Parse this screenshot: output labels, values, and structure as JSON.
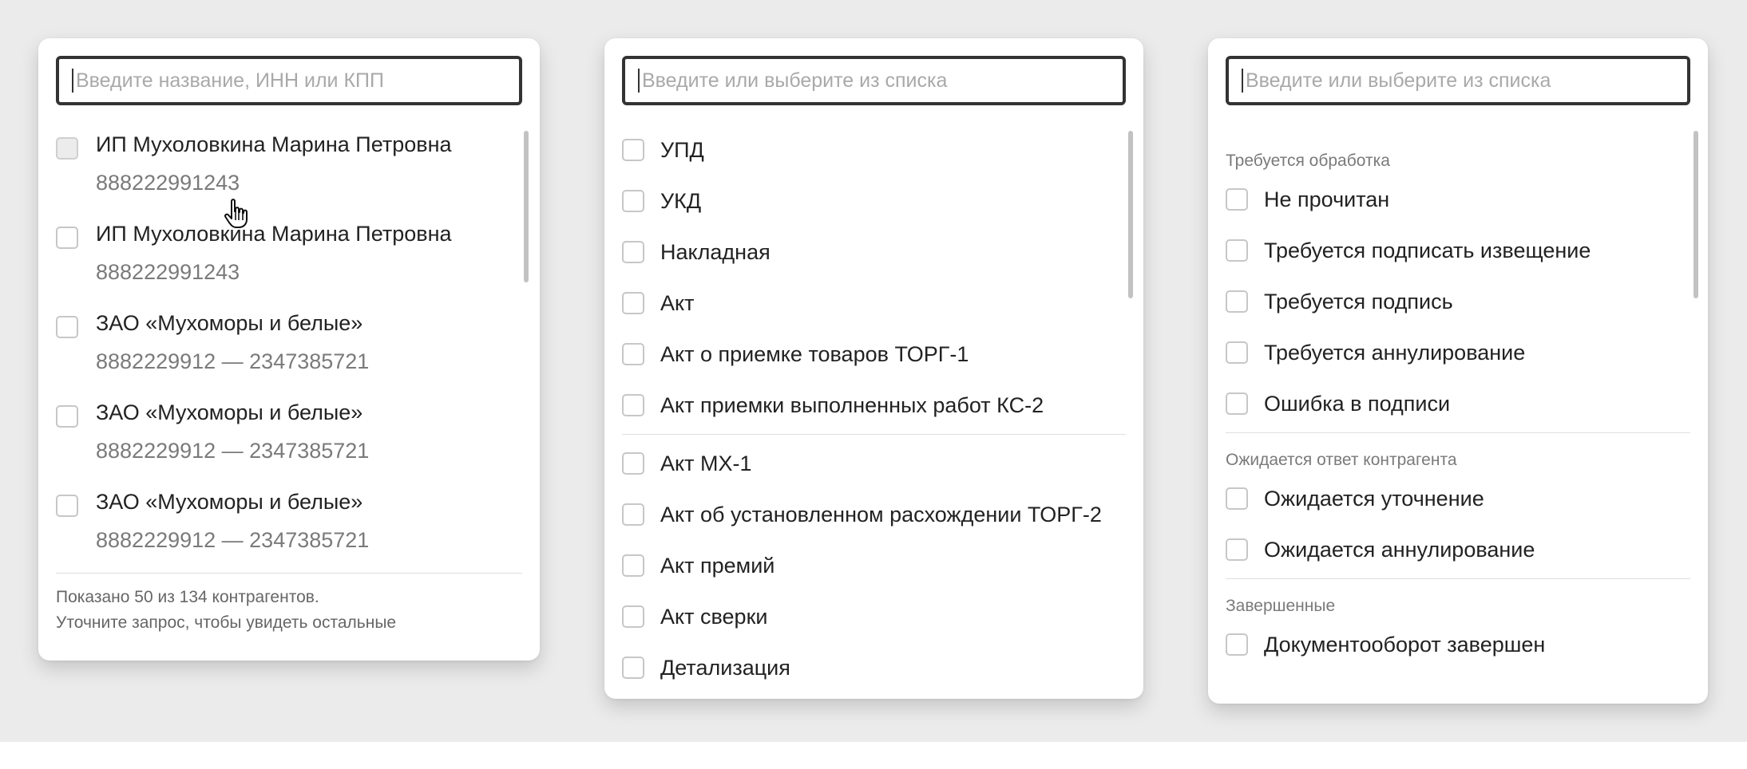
{
  "counterparty_panel": {
    "search_placeholder": "Введите название, ИНН или КПП",
    "items": [
      {
        "name": "ИП Мухоловкина Марина Петровна",
        "inn": "888222991243"
      },
      {
        "name": "ИП Мухоловкина Марина Петровна",
        "inn": "888222991243"
      },
      {
        "name": "ЗАО «Мухоморы и белые»",
        "inn": "8882229912 — 2347385721"
      },
      {
        "name": "ЗАО «Мухоморы и белые»",
        "inn": "8882229912 — 2347385721"
      },
      {
        "name": "ЗАО «Мухоморы и белые»",
        "inn": "8882229912 — 2347385721"
      }
    ],
    "footer_line1": "Показано 50 из 134 контрагентов.",
    "footer_line2": "Уточните запрос, чтобы увидеть остальные"
  },
  "doctype_panel": {
    "search_placeholder": "Введите или выберите из списка",
    "group1": [
      "УПД",
      "УКД",
      "Накладная",
      "Акт",
      "Акт о приемке товаров ТОРГ-1",
      "Акт приемки выполненных работ КС-2"
    ],
    "group2": [
      "Акт МХ-1",
      "Акт об установленном расхождении ТОРГ-2",
      "Акт премий",
      "Акт сверки",
      "Детализация"
    ]
  },
  "status_panel": {
    "search_placeholder": "Введите или выберите из списка",
    "groups": [
      {
        "label": "Требуется обработка",
        "items": [
          "Не прочитан",
          "Требуется подписать извещение",
          "Требуется подпись",
          "Требуется аннулирование",
          "Ошибка в подписи"
        ]
      },
      {
        "label": "Ожидается ответ контрагента",
        "items": [
          "Ожидается уточнение",
          "Ожидается аннулирование"
        ]
      },
      {
        "label": "Завершенные",
        "items": [
          "Документооборот завершен"
        ]
      }
    ]
  },
  "icons": {
    "cursor": "hand-pointer-icon"
  }
}
